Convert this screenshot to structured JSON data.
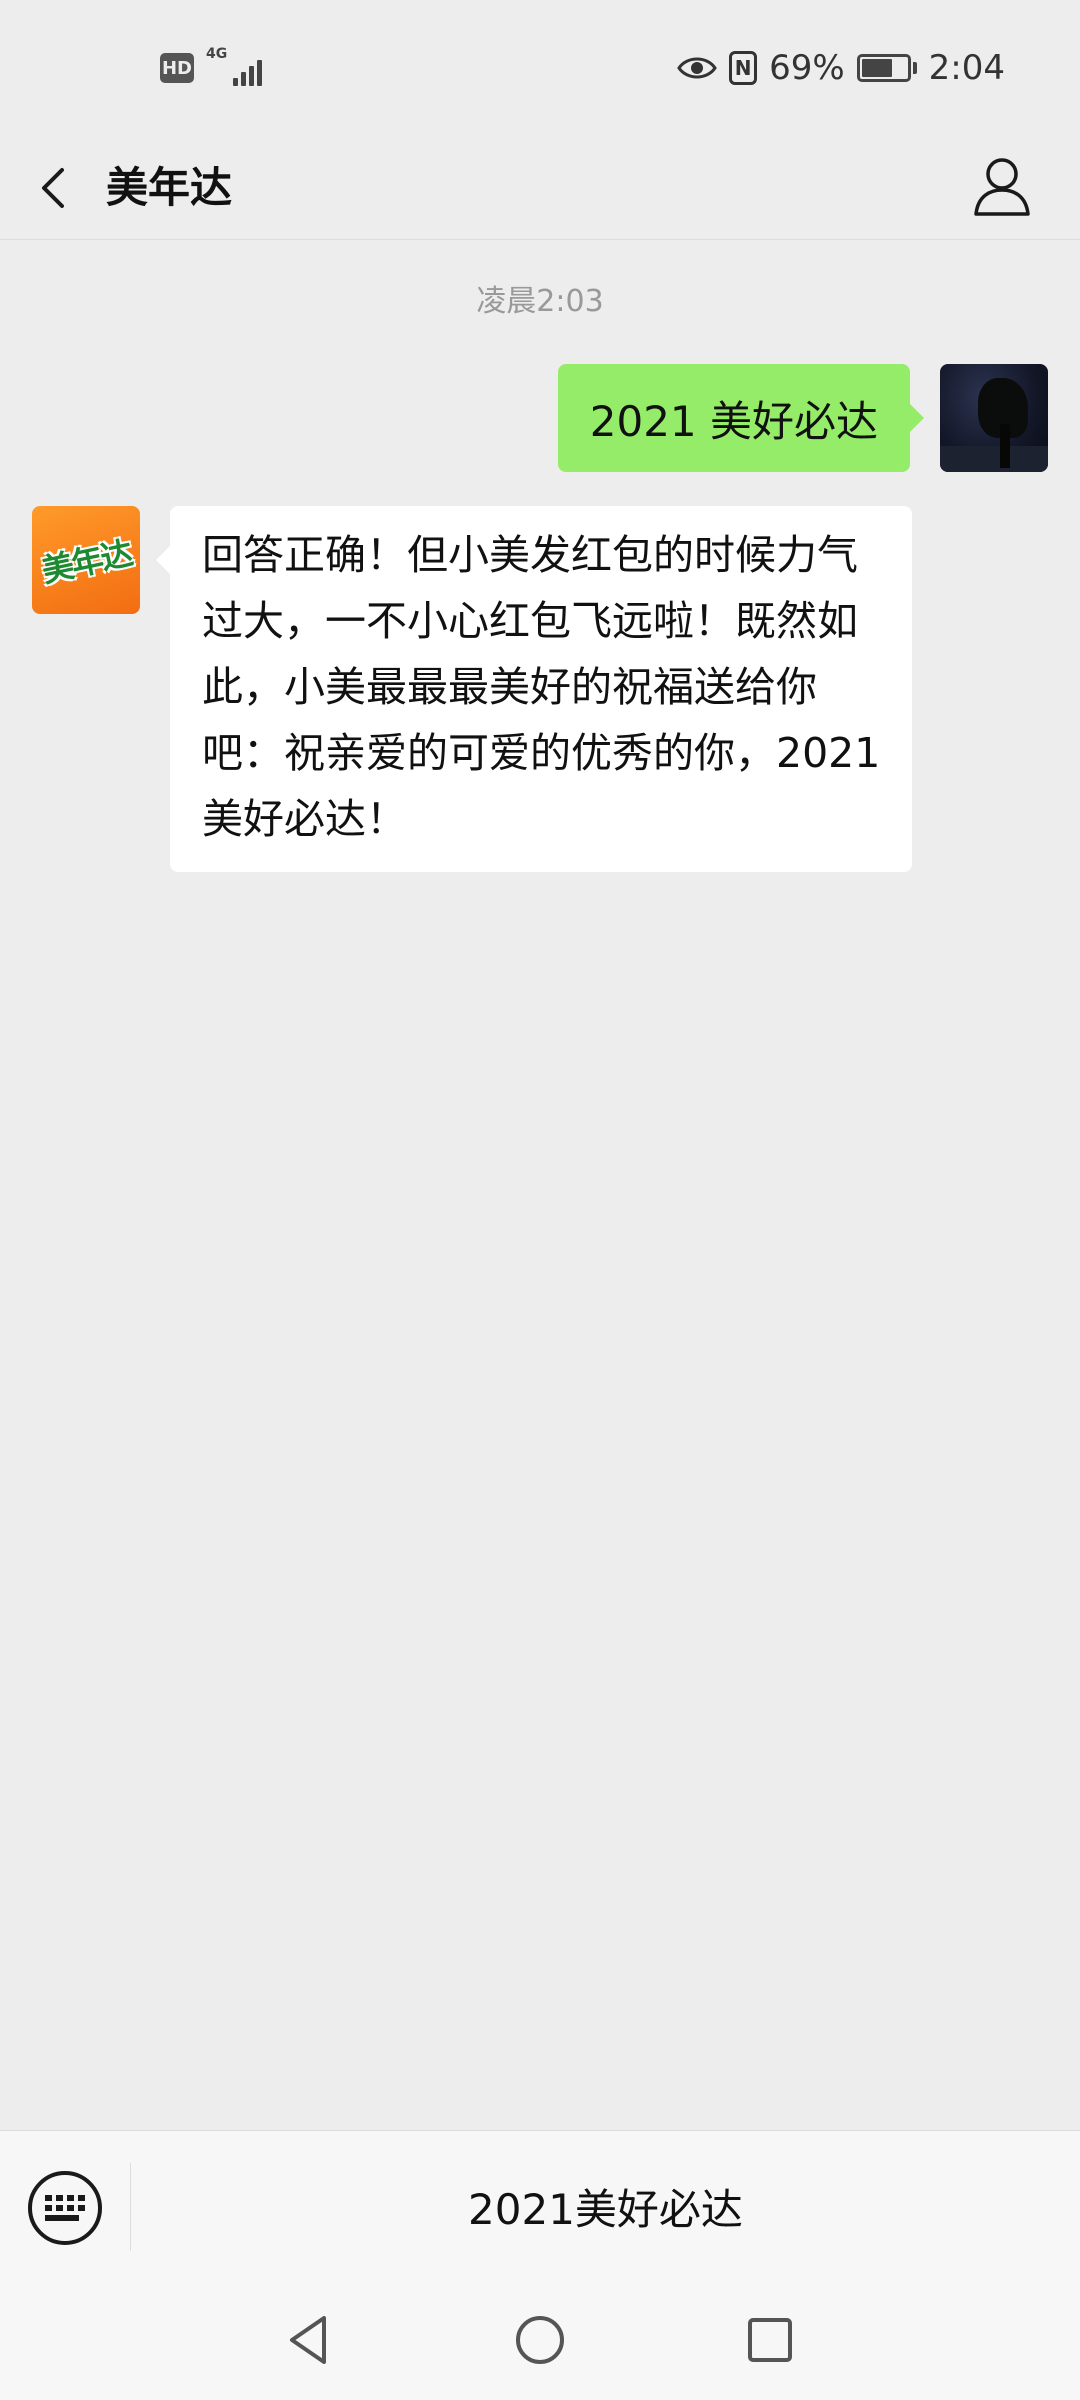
{
  "status_bar": {
    "hd_label": "HD",
    "network_label": "4G",
    "battery_percent": "69%",
    "battery_level": 0.69,
    "time": "2:04",
    "nfc_label": "N"
  },
  "header": {
    "title": "美年达"
  },
  "chat": {
    "timestamp": "凌晨2:03",
    "messages": [
      {
        "from": "me",
        "text": "2021 美好必达"
      },
      {
        "from": "bot",
        "text": "回答正确！但小美发红包的时候力气过大，一不小心红包飞远啦！既然如此，小美最最最美好的祝福送给你吧：祝亲爱的可爱的优秀的你，2021 美好必达！"
      }
    ],
    "bot_avatar_text": "美年达"
  },
  "input_bar": {
    "quick_reply": "2021美好必达"
  },
  "colors": {
    "background": "#ededed",
    "sent_bubble": "#95ec69",
    "received_bubble": "#ffffff",
    "bot_avatar": "#f26d12"
  },
  "icons": [
    "back-icon",
    "profile-icon",
    "eye-icon",
    "nfc-icon",
    "battery-icon",
    "keyboard-icon",
    "nav-back-icon",
    "nav-home-icon",
    "nav-recent-icon"
  ]
}
